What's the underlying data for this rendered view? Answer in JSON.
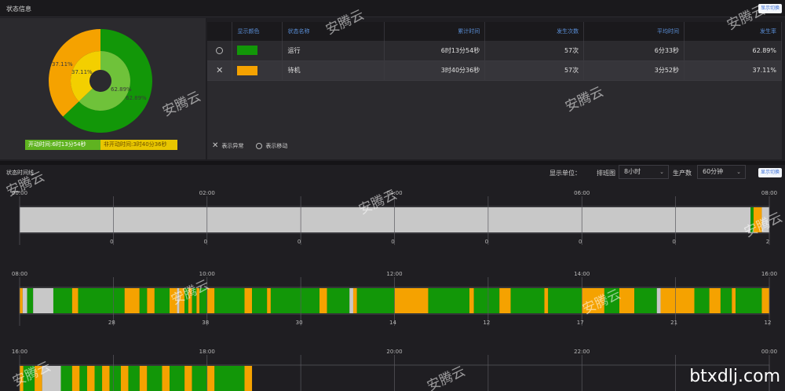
{
  "status_info": {
    "title": "状态信息",
    "toggle_label": "显示切换"
  },
  "pie": {
    "outer": [
      {
        "label": "62.89%",
        "value": 62.89,
        "color": "#129708"
      },
      {
        "label": "37.11%",
        "value": 37.11,
        "color": "#f5a200"
      }
    ],
    "inner": [
      {
        "label": "62.89%",
        "value": 62.89,
        "color": "#6fc23a"
      },
      {
        "label": "37.11%",
        "value": 37.11,
        "color": "#f3cf00"
      }
    ],
    "legend_run": "开动时间:6时13分54秒",
    "legend_idle": "非开动时间:3时40分36秒"
  },
  "table": {
    "headers": [
      "显示颜色",
      "状态名称",
      "累计时间",
      "发生次数",
      "平均时间",
      "发生率"
    ],
    "rows": [
      {
        "marker": "○",
        "color": "#129708",
        "name": "运行",
        "total": "6时13分54秒",
        "count": "57次",
        "avg": "6分33秒",
        "rate": "62.89%"
      },
      {
        "marker": "×",
        "color": "#f5a200",
        "name": "待机",
        "total": "3时40分36秒",
        "count": "57次",
        "avg": "3分52秒",
        "rate": "37.11%"
      }
    ],
    "footer_abnormal": "表示异常",
    "footer_move": "表示移动"
  },
  "timeline": {
    "title": "状态时间线",
    "unit_label": "显示单位：",
    "sort_label": "排班图",
    "sort_value": "8小时",
    "prod_label": "生产数",
    "prod_value": "60分钟",
    "toggle_label": "显示切换",
    "rows": [
      {
        "ticks": [
          "00:00",
          "02:00",
          "04:00",
          "06:00",
          "08:00"
        ],
        "counts": [
          "0",
          "0",
          "0",
          "0",
          "0",
          "0",
          "0",
          "2"
        ],
        "segments": [
          [
            0,
            0.975,
            "#c8c8c8"
          ],
          [
            0.975,
            0.979,
            "#129708"
          ],
          [
            0.979,
            0.99,
            "#f5a200"
          ],
          [
            0.99,
            1.0,
            "#c8c8c8"
          ]
        ]
      },
      {
        "ticks": [
          "08:00",
          "10:00",
          "12:00",
          "14:00",
          "16:00"
        ],
        "counts": [
          "28",
          "38",
          "30",
          "14",
          "12",
          "17",
          "21",
          "12"
        ],
        "segments": [
          [
            0,
            0.004,
            "#f5a200"
          ],
          [
            0.004,
            0.01,
            "#c8c8c8"
          ],
          [
            0.01,
            0.018,
            "#129708"
          ],
          [
            0.018,
            0.045,
            "#c8c8c8"
          ],
          [
            0.045,
            0.07,
            "#129708"
          ],
          [
            0.07,
            0.078,
            "#f5a200"
          ],
          [
            0.078,
            0.14,
            "#129708"
          ],
          [
            0.14,
            0.16,
            "#f5a200"
          ],
          [
            0.16,
            0.17,
            "#129708"
          ],
          [
            0.17,
            0.18,
            "#f5a200"
          ],
          [
            0.18,
            0.2,
            "#129708"
          ],
          [
            0.2,
            0.21,
            "#f5a200"
          ],
          [
            0.21,
            0.213,
            "#c8c8c8"
          ],
          [
            0.213,
            0.22,
            "#f5a200"
          ],
          [
            0.22,
            0.225,
            "#129708"
          ],
          [
            0.225,
            0.23,
            "#f5a200"
          ],
          [
            0.23,
            0.236,
            "#129708"
          ],
          [
            0.236,
            0.24,
            "#f5a200"
          ],
          [
            0.24,
            0.25,
            "#129708"
          ],
          [
            0.25,
            0.26,
            "#f5a200"
          ],
          [
            0.26,
            0.3,
            "#129708"
          ],
          [
            0.3,
            0.31,
            "#f5a200"
          ],
          [
            0.31,
            0.33,
            "#129708"
          ],
          [
            0.33,
            0.335,
            "#f5a200"
          ],
          [
            0.335,
            0.4,
            "#129708"
          ],
          [
            0.4,
            0.41,
            "#f5a200"
          ],
          [
            0.41,
            0.44,
            "#129708"
          ],
          [
            0.44,
            0.445,
            "#c8c8c8"
          ],
          [
            0.445,
            0.45,
            "#f5a200"
          ],
          [
            0.45,
            0.5,
            "#129708"
          ],
          [
            0.5,
            0.545,
            "#f5a200"
          ],
          [
            0.545,
            0.6,
            "#129708"
          ],
          [
            0.6,
            0.606,
            "#f5a200"
          ],
          [
            0.606,
            0.64,
            "#129708"
          ],
          [
            0.64,
            0.655,
            "#f5a200"
          ],
          [
            0.655,
            0.7,
            "#129708"
          ],
          [
            0.7,
            0.705,
            "#f5a200"
          ],
          [
            0.705,
            0.75,
            "#129708"
          ],
          [
            0.75,
            0.78,
            "#f5a200"
          ],
          [
            0.78,
            0.8,
            "#129708"
          ],
          [
            0.8,
            0.82,
            "#f5a200"
          ],
          [
            0.82,
            0.85,
            "#129708"
          ],
          [
            0.85,
            0.855,
            "#c8c8c8"
          ],
          [
            0.855,
            0.9,
            "#f5a200"
          ],
          [
            0.9,
            0.92,
            "#129708"
          ],
          [
            0.92,
            0.935,
            "#f5a200"
          ],
          [
            0.935,
            0.95,
            "#129708"
          ],
          [
            0.95,
            0.955,
            "#f5a200"
          ],
          [
            0.955,
            0.99,
            "#129708"
          ],
          [
            0.99,
            1.0,
            "#f5a200"
          ]
        ]
      },
      {
        "ticks": [
          "16:00",
          "18:00",
          "20:00",
          "22:00",
          "00:00"
        ],
        "counts": [],
        "segments": [
          [
            0,
            0.005,
            "#f5a200"
          ],
          [
            0.005,
            0.02,
            "#129708"
          ],
          [
            0.02,
            0.03,
            "#f5a200"
          ],
          [
            0.03,
            0.055,
            "#c8c8c8"
          ],
          [
            0.055,
            0.07,
            "#129708"
          ],
          [
            0.07,
            0.08,
            "#f5a200"
          ],
          [
            0.08,
            0.09,
            "#129708"
          ],
          [
            0.09,
            0.1,
            "#f5a200"
          ],
          [
            0.1,
            0.11,
            "#129708"
          ],
          [
            0.11,
            0.12,
            "#f5a200"
          ],
          [
            0.12,
            0.135,
            "#129708"
          ],
          [
            0.135,
            0.145,
            "#f5a200"
          ],
          [
            0.145,
            0.16,
            "#129708"
          ],
          [
            0.16,
            0.17,
            "#f5a200"
          ],
          [
            0.17,
            0.19,
            "#129708"
          ],
          [
            0.19,
            0.2,
            "#f5a200"
          ],
          [
            0.2,
            0.22,
            "#129708"
          ],
          [
            0.22,
            0.23,
            "#f5a200"
          ],
          [
            0.23,
            0.25,
            "#129708"
          ],
          [
            0.25,
            0.26,
            "#f5a200"
          ],
          [
            0.26,
            0.3,
            "#129708"
          ],
          [
            0.3,
            0.31,
            "#f5a200"
          ]
        ]
      }
    ]
  },
  "watermarks": [
    "安腾云",
    "安腾云",
    "安腾云",
    "安腾云",
    "安腾云",
    "安腾云",
    "安腾云",
    "安腾云",
    "安腾云",
    "安腾云",
    "安腾云"
  ],
  "site_mark": "btxdlj.com"
}
